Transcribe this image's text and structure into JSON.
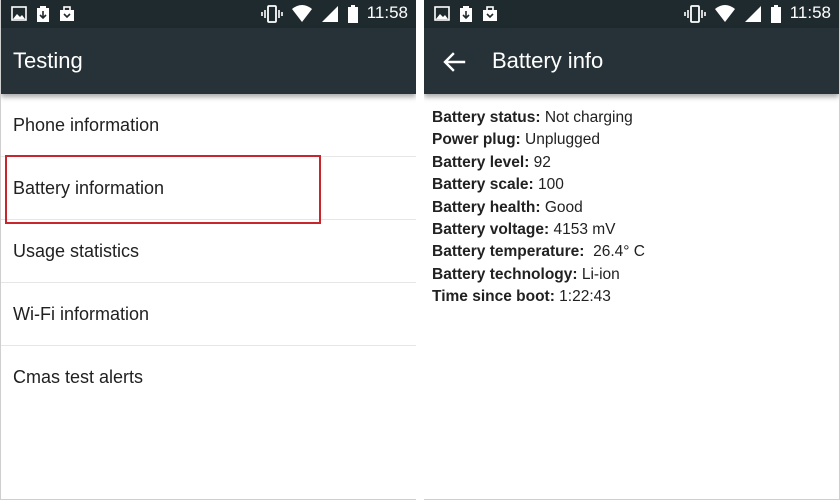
{
  "status_bar": {
    "time": "11:58",
    "left_icons": [
      "image-icon",
      "clipboard-download-icon",
      "briefcase-icon"
    ],
    "right_icons": [
      "vibrate-icon",
      "wifi-icon",
      "signal-icon",
      "battery-icon"
    ]
  },
  "left_screen": {
    "title": "Testing",
    "items": [
      {
        "label": "Phone information"
      },
      {
        "label": "Battery information",
        "highlighted": true
      },
      {
        "label": "Usage statistics"
      },
      {
        "label": "Wi-Fi information"
      },
      {
        "label": "Cmas test alerts"
      }
    ],
    "highlight_color": "#c8262d"
  },
  "right_screen": {
    "title": "Battery info",
    "back_icon": "arrow-back-icon",
    "rows": [
      {
        "label": "Battery status:",
        "value": " Not charging"
      },
      {
        "label": "Power plug:",
        "value": " Unplugged"
      },
      {
        "label": "Battery level:",
        "value": " 92"
      },
      {
        "label": "Battery scale:",
        "value": " 100"
      },
      {
        "label": "Battery health:",
        "value": " Good"
      },
      {
        "label": "Battery voltage:",
        "value": " 4153 mV"
      },
      {
        "label": "Battery temperature:",
        "value": "  26.4° C"
      },
      {
        "label": "Battery technology:",
        "value": " Li-ion"
      },
      {
        "label": "Time since boot:",
        "value": " 1:22:43"
      }
    ]
  },
  "colors": {
    "status_bar": "#1f2a2f",
    "app_bar": "#263238",
    "text": "#212121"
  }
}
